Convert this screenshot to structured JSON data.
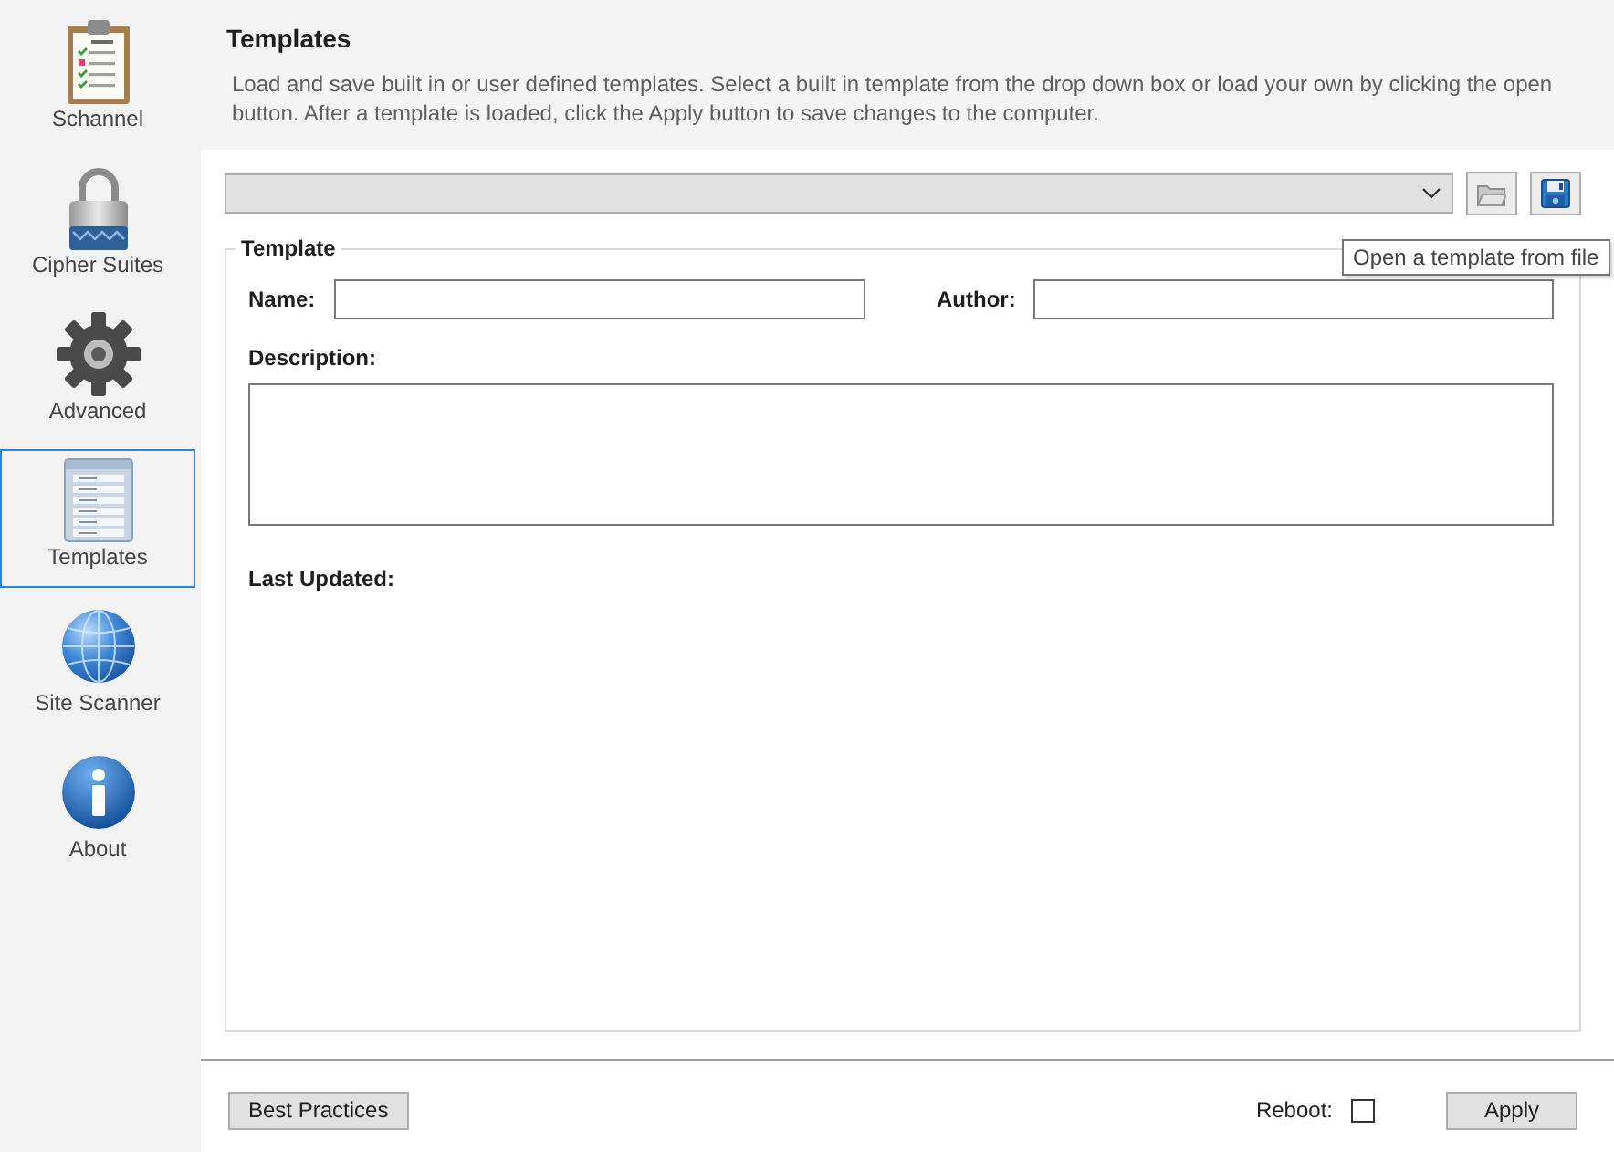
{
  "sidebar": {
    "items": [
      {
        "label": "Schannel",
        "selected": false
      },
      {
        "label": "Cipher Suites",
        "selected": false
      },
      {
        "label": "Advanced",
        "selected": false
      },
      {
        "label": "Templates",
        "selected": true
      },
      {
        "label": "Site Scanner",
        "selected": false
      },
      {
        "label": "About",
        "selected": false
      }
    ]
  },
  "header": {
    "title": "Templates",
    "description": "Load and save built in or user defined templates. Select a built in template from the drop down box or load your own by clicking the open button. After a template is loaded, click the Apply button to save changes to the computer."
  },
  "toolbar": {
    "tooltip": "Open a template from file"
  },
  "template_group": {
    "title": "Template",
    "fields": [
      {
        "label": "Name:",
        "kind": "input"
      },
      {
        "label": "Author:",
        "kind": "input"
      },
      {
        "label": "Description:",
        "kind": "textarea"
      },
      {
        "label": "Last Updated:",
        "kind": "text"
      }
    ]
  },
  "footer": {
    "best_practices_button": "Best Practices",
    "reboot": {
      "label": "Reboot:",
      "checked": false
    },
    "apply_button": "Apply"
  }
}
